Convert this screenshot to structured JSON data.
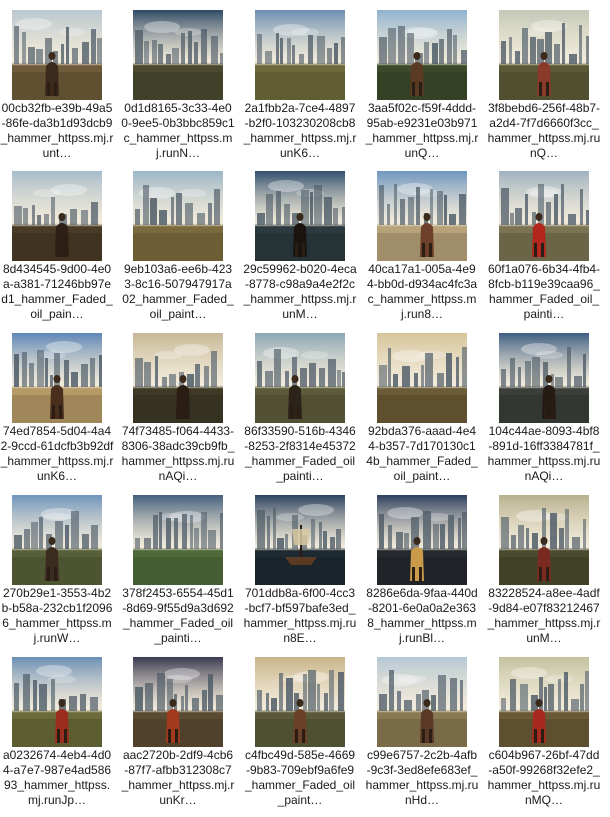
{
  "files": [
    {
      "name": "00cb32fb-e39b-49a5-86fe-da3b1d93dcb9_hammer_httpss.mj.runt…",
      "palette": {
        "sky": "#b9c7d1",
        "ground": "#6f5a3a",
        "accent": "#3b2a1c"
      },
      "figure": true,
      "ship": false,
      "icon": "oil-painting-thumbnail-icon"
    },
    {
      "name": "0d1d8165-3c33-4e00-9ee5-0b3bbc859c1c_hammer_httpss.mj.runN…",
      "palette": {
        "sky": "#2f4a66",
        "ground": "#4b4a2f",
        "accent": "#d9b26a"
      },
      "figure": false,
      "ship": false,
      "icon": "oil-painting-thumbnail-icon"
    },
    {
      "name": "2a1fbb2a-7ce4-4897-b2f0-103230208cb8_hammer_httpss.mj.runK6…",
      "palette": {
        "sky": "#6c8fb3",
        "ground": "#6e6a3b",
        "accent": "#c87a3a"
      },
      "figure": false,
      "ship": false,
      "icon": "oil-painting-thumbnail-icon"
    },
    {
      "name": "3aa5f02c-f59f-4ddd-95ab-e9231e03b971_hammer_httpss.mj.runQ…",
      "palette": {
        "sky": "#8fb2cf",
        "ground": "#3c4a2a",
        "accent": "#5a3a22"
      },
      "figure": true,
      "ship": false,
      "icon": "oil-painting-thumbnail-icon"
    },
    {
      "name": "3f8bebd6-256f-48b7-a2d4-7f7d6660f3cc_hammer_httpss.mj.runQ…",
      "palette": {
        "sky": "#c3c9b7",
        "ground": "#5c5a36",
        "accent": "#8a3a2a"
      },
      "figure": true,
      "ship": false,
      "icon": "oil-painting-thumbnail-icon"
    },
    {
      "name": "8d434545-9d00-4e0a-a381-71246bb97ed1_hammer_Faded_oil_pain…",
      "palette": {
        "sky": "#a7bccc",
        "ground": "#4a3b26",
        "accent": "#2c2016"
      },
      "figure": true,
      "ship": false,
      "icon": "oil-painting-thumbnail-icon"
    },
    {
      "name": "9eb103a6-ee6b-4233-8c16-507947917a02_hammer_Faded_oil_paint…",
      "palette": {
        "sky": "#9bb6c8",
        "ground": "#7b6a3d",
        "accent": "#3a3222"
      },
      "figure": false,
      "ship": false,
      "icon": "oil-painting-thumbnail-icon"
    },
    {
      "name": "29c59962-b020-4eca-8778-c98a9a4e2f2c_hammer_httpss.mj.runM…",
      "palette": {
        "sky": "#31506e",
        "ground": "#2b3a3e",
        "accent": "#1a1410"
      },
      "figure": true,
      "ship": false,
      "icon": "oil-painting-thumbnail-icon"
    },
    {
      "name": "40ca17a1-005a-4e94-bb0d-d934ac4fc3ac_hammer_httpss.mj.run8…",
      "palette": {
        "sky": "#6f96bf",
        "ground": "#b7a27a",
        "accent": "#6e3f2a"
      },
      "figure": true,
      "ship": false,
      "icon": "oil-painting-thumbnail-icon"
    },
    {
      "name": "60f1a076-6b34-4fb4-8fcb-b119e39caa96_hammer_Faded_oil_painti…",
      "palette": {
        "sky": "#9fb2c2",
        "ground": "#7a7452",
        "accent": "#b3261e"
      },
      "figure": true,
      "ship": false,
      "icon": "oil-painting-thumbnail-icon"
    },
    {
      "name": "74ed7854-5d04-4a42-9ccd-61dcfb3b92df_hammer_httpss.mj.runK6…",
      "palette": {
        "sky": "#5e87b7",
        "ground": "#b59a66",
        "accent": "#4a2e1e"
      },
      "figure": true,
      "ship": false,
      "icon": "oil-painting-thumbnail-icon"
    },
    {
      "name": "74f73485-f064-4433-8306-38adc39cb9fb_hammer_httpss.mj.runAQi…",
      "palette": {
        "sky": "#c6b896",
        "ground": "#3e3a26",
        "accent": "#2a1d14"
      },
      "figure": true,
      "ship": false,
      "icon": "oil-painting-thumbnail-icon"
    },
    {
      "name": "86f33590-516b-4346-8253-2f8314e45372_hammer_Faded_oil_painti…",
      "palette": {
        "sky": "#8da7b7",
        "ground": "#5d5c3a",
        "accent": "#2c2418"
      },
      "figure": true,
      "ship": false,
      "icon": "oil-painting-thumbnail-icon"
    },
    {
      "name": "92bda376-aaad-4e44-b357-7d170130c14b_hammer_Faded_oil_paint…",
      "palette": {
        "sky": "#d6c49a",
        "ground": "#6b5b36",
        "accent": "#9a4a24"
      },
      "figure": false,
      "ship": false,
      "icon": "oil-painting-thumbnail-icon"
    },
    {
      "name": "104c44ae-8093-4bf8-891d-16ff3384781f_hammer_httpss.mj.runAQi…",
      "palette": {
        "sky": "#3e5e82",
        "ground": "#3a3f3a",
        "accent": "#261a14"
      },
      "figure": true,
      "ship": false,
      "icon": "oil-painting-thumbnail-icon"
    },
    {
      "name": "270b29e1-3553-4b2b-b58a-232cb1f20966_hammer_httpss.mj.runW…",
      "palette": {
        "sky": "#6f95bd",
        "ground": "#57603a",
        "accent": "#3a2c1e"
      },
      "figure": true,
      "ship": false,
      "icon": "oil-painting-thumbnail-icon"
    },
    {
      "name": "378f2453-6554-45d1-8d69-9f55d9a3d692_hammer_Faded_oil_painti…",
      "palette": {
        "sky": "#445f7e",
        "ground": "#4e6a3a",
        "accent": "#2c241c"
      },
      "figure": false,
      "ship": false,
      "icon": "oil-painting-thumbnail-icon"
    },
    {
      "name": "701ddb8a-6f00-4cc3-bcf7-bf597bafe3ed_hammer_httpss.mj.run8E…",
      "palette": {
        "sky": "#2c4460",
        "ground": "#1e2a32",
        "accent": "#5a3a22"
      },
      "figure": false,
      "ship": true,
      "icon": "oil-painting-thumbnail-icon"
    },
    {
      "name": "8286e6da-9faa-440d-8201-6e0a0a2e3638_hammer_httpss.mj.runBl…",
      "palette": {
        "sky": "#2d3f5e",
        "ground": "#252a2e",
        "accent": "#c89a4a"
      },
      "figure": true,
      "ship": false,
      "icon": "oil-painting-thumbnail-icon"
    },
    {
      "name": "83228524-a8ee-4adf-9d84-e07f83212467_hammer_httpss.mj.runM…",
      "palette": {
        "sky": "#b7b08e",
        "ground": "#4a4a2e",
        "accent": "#7a2a1e"
      },
      "figure": true,
      "ship": false,
      "icon": "oil-painting-thumbnail-icon"
    },
    {
      "name": "a0232674-4eb4-4d04-a7e7-987e4ad58693_hammer_httpss.mj.runJp…",
      "palette": {
        "sky": "#6b8fb6",
        "ground": "#6a6a3a",
        "accent": "#9c2c1e"
      },
      "figure": true,
      "ship": false,
      "icon": "oil-painting-thumbnail-icon"
    },
    {
      "name": "aac2720b-2df9-4cb6-87f7-afbb312308c7_hammer_httpss.mj.runKr…",
      "palette": {
        "sky": "#3a3a52",
        "ground": "#5a4a32",
        "accent": "#a23a1e"
      },
      "figure": true,
      "ship": false,
      "icon": "oil-painting-thumbnail-icon"
    },
    {
      "name": "c4fbc49d-585e-4669-9b83-709ebf9a6fe9_hammer_Faded_oil_paint…",
      "palette": {
        "sky": "#c9b48a",
        "ground": "#5a5a3a",
        "accent": "#6a4028"
      },
      "figure": true,
      "ship": false,
      "icon": "oil-painting-thumbnail-icon"
    },
    {
      "name": "c99e6757-2c2b-4afb-9c3f-3ed8efe683ef_hammer_httpss.mj.runHd…",
      "palette": {
        "sky": "#b5c8d6",
        "ground": "#8a7a52",
        "accent": "#5a3a26"
      },
      "figure": true,
      "ship": false,
      "icon": "oil-painting-thumbnail-icon"
    },
    {
      "name": "c604b967-26bf-47dd-a50f-99268f32efe2_hammer_httpss.mj.runMQ…",
      "palette": {
        "sky": "#c3c2a0",
        "ground": "#6a5a36",
        "accent": "#a82a1e"
      },
      "figure": true,
      "ship": false,
      "icon": "oil-painting-thumbnail-icon"
    }
  ]
}
